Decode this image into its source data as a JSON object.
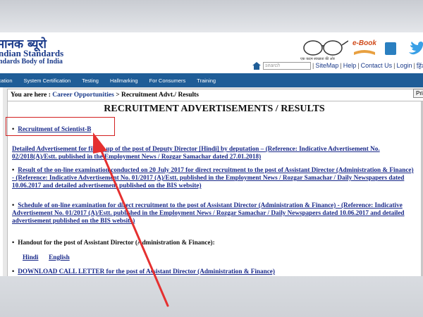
{
  "header": {
    "logo_hindi": "मानक ब्यूरो",
    "logo_line1": "ndian Standards",
    "logo_line2": "ndards Body of India",
    "swachh_text": "एक कदम स्वच्छता की ओर",
    "ebook_label": "e-Book"
  },
  "toolbar": {
    "search_placeholder": "search",
    "links": [
      "SiteMap",
      "Help",
      "Contact Us",
      "Login",
      "हिंदी संस्क"
    ]
  },
  "nav": {
    "items": [
      "tification",
      "System Certification",
      "Testing",
      "Hallmarking",
      "For Consumers",
      "Training"
    ]
  },
  "breadcrumb": {
    "prefix": "You are here :",
    "link": "Career Opportunities",
    "current": "> Recruitment Advt./ Results",
    "print_label": "Prin"
  },
  "content": {
    "title": "RECRUITMENT ADVERTISEMENTS / RESULTS",
    "items": [
      {
        "text": "Recruitment of Scientist-B"
      },
      {
        "text": "Detailed Advertisement for filling up of the post of Deputy Director [Hindi] by deputation – (Reference: Indicative Advertisement No. 02/2018(A)/Estt. published in the Employment News / Rozgar Samachar dated 27.01.2018)"
      },
      {
        "text": "Result of the on-line examination conducted on 20 July 2017 for direct recruitment to the post of Assistant Director (Administration & Finance) - (Reference: Indicative Advertisement No. 01/2017 (A)/Estt. published in the Employment News / Rozgar Samachar / Daily Newspapers dated 10.06.2017 and detailed advertisement published on the BIS website)"
      },
      {
        "text": "Schedule of on-line examination for direct recruitment to the post of Assistant Director (Administration & Finance) - (Reference: Indicative Advertisement No. 01/2017 (A)/Estt. published in the Employment News / Rozgar Samachar / Daily Newspapers dated 10.06.2017 and detailed advertisement published on the BIS website)"
      },
      {
        "text": "Handout for the post of Assistant Director (Administration & Finance):"
      },
      {
        "text": "DOWNLOAD CALL LETTER for the post of Assistant Director (Administration & Finance)"
      }
    ],
    "languages": [
      "Hindi",
      "English"
    ]
  },
  "colors": {
    "nav_bg": "#1f5d97",
    "link": "#1a2a8a",
    "highlight": "#d32020"
  }
}
